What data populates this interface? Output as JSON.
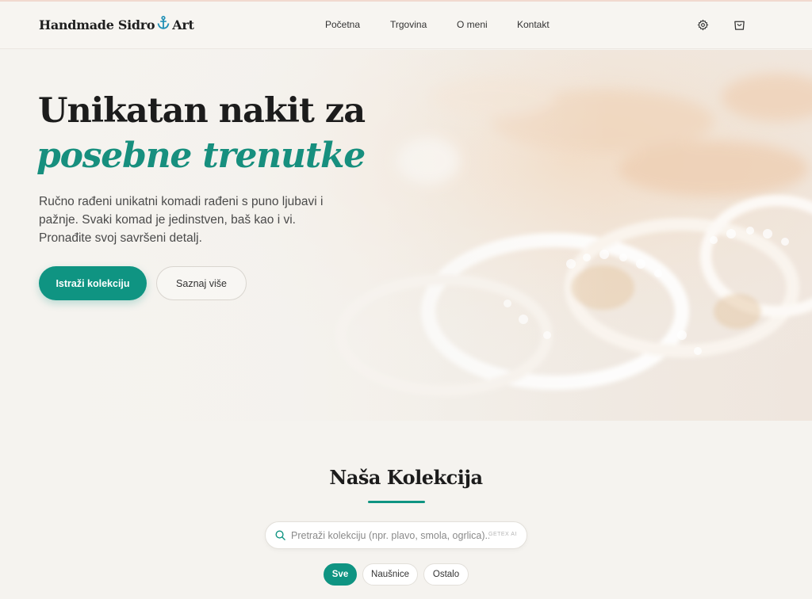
{
  "header": {
    "logo_pre": "Handmade Sidro",
    "logo_post": "Art",
    "nav": [
      {
        "label": "Početna"
      },
      {
        "label": "Trgovina"
      },
      {
        "label": "O meni"
      },
      {
        "label": "Kontakt"
      }
    ],
    "icons": [
      "gear-icon",
      "shopping-bag-icon"
    ]
  },
  "hero": {
    "title_line1": "Unikatan nakit za",
    "title_line2": "posebne trenutke",
    "description": "Ručno rađeni unikatni komadi rađeni s puno ljubavi i pažnje. Svaki komad je jedinstven, baš kao i vi. Pronađite svoj savršeni detalj.",
    "primary_button": "Istraži kolekciju",
    "secondary_button": "Saznaj više"
  },
  "collection": {
    "title": "Naša Kolekcija",
    "search_placeholder": "Pretraži kolekciju (npr. plavo, smola, ogrlica)...",
    "search_badge": "GETEX AI",
    "filters": [
      {
        "label": "Sve",
        "active": true
      },
      {
        "label": "Naušnice",
        "active": false
      },
      {
        "label": "Ostalo",
        "active": false
      }
    ]
  },
  "colors": {
    "accent": "#0f9482",
    "background": "#f5f3ef",
    "anchor": "#1f8fb5"
  }
}
